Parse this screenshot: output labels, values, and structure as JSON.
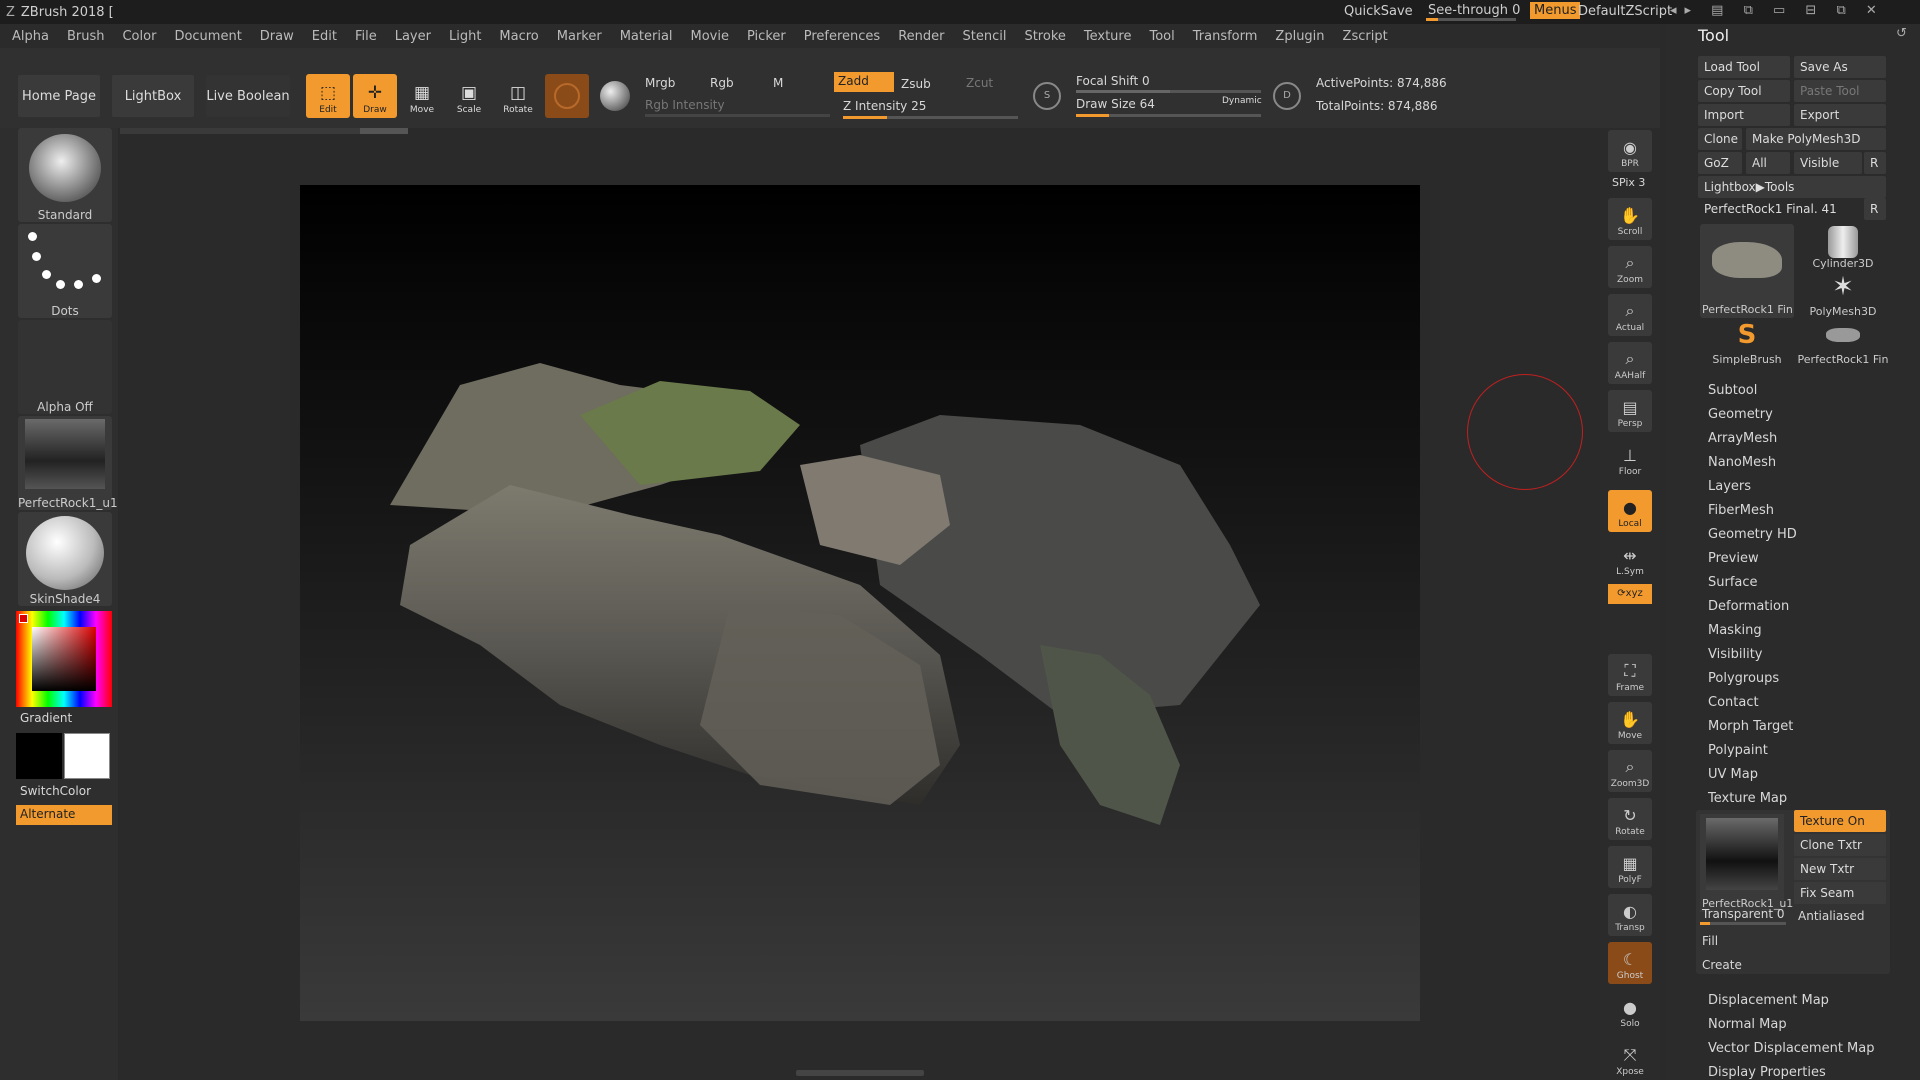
{
  "app": {
    "title": "ZBrush 2018 [",
    "quicksave": "QuickSave",
    "see_through": "See-through  0",
    "menus": "Menus",
    "script": "DefaultZScript"
  },
  "menubar": [
    "Alpha",
    "Brush",
    "Color",
    "Document",
    "Draw",
    "Edit",
    "File",
    "Layer",
    "Light",
    "Macro",
    "Marker",
    "Material",
    "Movie",
    "Picker",
    "Preferences",
    "Render",
    "Stencil",
    "Stroke",
    "Texture",
    "Tool",
    "Transform",
    "Zplugin",
    "Zscript"
  ],
  "shelf": {
    "home": "Home Page",
    "lightbox": "LightBox",
    "live_boolean": "Live Boolean",
    "edit": "Edit",
    "draw": "Draw",
    "move": "Move",
    "scale": "Scale",
    "rotate": "Rotate",
    "mrgb": "Mrgb",
    "rgb": "Rgb",
    "m": "M",
    "zadd": "Zadd",
    "zsub": "Zsub",
    "zcut": "Zcut",
    "rgb_intensity": "Rgb Intensity",
    "z_intensity": "Z Intensity 25",
    "focal_shift": "Focal Shift 0",
    "draw_size": "Draw Size 64",
    "dynamic": "Dynamic",
    "active_points": "ActivePoints: 874,886",
    "total_points": "TotalPoints: 874,886",
    "z_intensity_value": 25,
    "draw_size_value": 64
  },
  "left": {
    "brush": "Standard",
    "stroke": "Dots",
    "alpha": "Alpha Off",
    "texture": "PerfectRock1_u1",
    "material": "SkinShade4",
    "gradient": "Gradient",
    "switch": "SwitchColor",
    "alternate": "Alternate"
  },
  "rtools": [
    "BPR",
    "SPix 3",
    "Scroll",
    "Zoom",
    "Actual",
    "AAHalf",
    "Persp",
    "Floor",
    "Local",
    "L.Sym",
    "Frame",
    "Move",
    "Zoom3D",
    "Rotate",
    "PolyF",
    "Transp",
    "Ghost",
    "Solo",
    "Xpose"
  ],
  "tool": {
    "title": "Tool",
    "load": "Load Tool",
    "save_as": "Save As",
    "copy": "Copy Tool",
    "paste": "Paste Tool",
    "import": "Import",
    "export": "Export",
    "clone": "Clone",
    "make_poly": "Make PolyMesh3D",
    "goz": "GoZ",
    "all": "All",
    "visible": "Visible",
    "r": "R",
    "lightbox_tools": "Lightbox▶Tools",
    "current": "PerfectRock1 Final. 41",
    "thumbs": [
      "PerfectRock1 Fin",
      "Cylinder3D",
      "PolyMesh3D",
      "SimpleBrush",
      "PerfectRock1 Fin"
    ],
    "sections": [
      "Subtool",
      "Geometry",
      "ArrayMesh",
      "NanoMesh",
      "Layers",
      "FiberMesh",
      "Geometry HD",
      "Preview",
      "Surface",
      "Deformation",
      "Masking",
      "Visibility",
      "Polygroups",
      "Contact",
      "Morph Target",
      "Polypaint",
      "UV Map",
      "Texture Map"
    ],
    "texture_map": {
      "texture_on": "Texture On",
      "clone_txtr": "Clone Txtr",
      "new_txtr": "New Txtr",
      "fix_seam": "Fix Seam",
      "thumb": "PerfectRock1_u1",
      "transparent": "Transparent 0",
      "antialiased": "Antialiased",
      "fill": "Fill",
      "create": "Create"
    },
    "more": [
      "Displacement Map",
      "Normal Map",
      "Vector Displacement Map",
      "Display Properties"
    ]
  }
}
